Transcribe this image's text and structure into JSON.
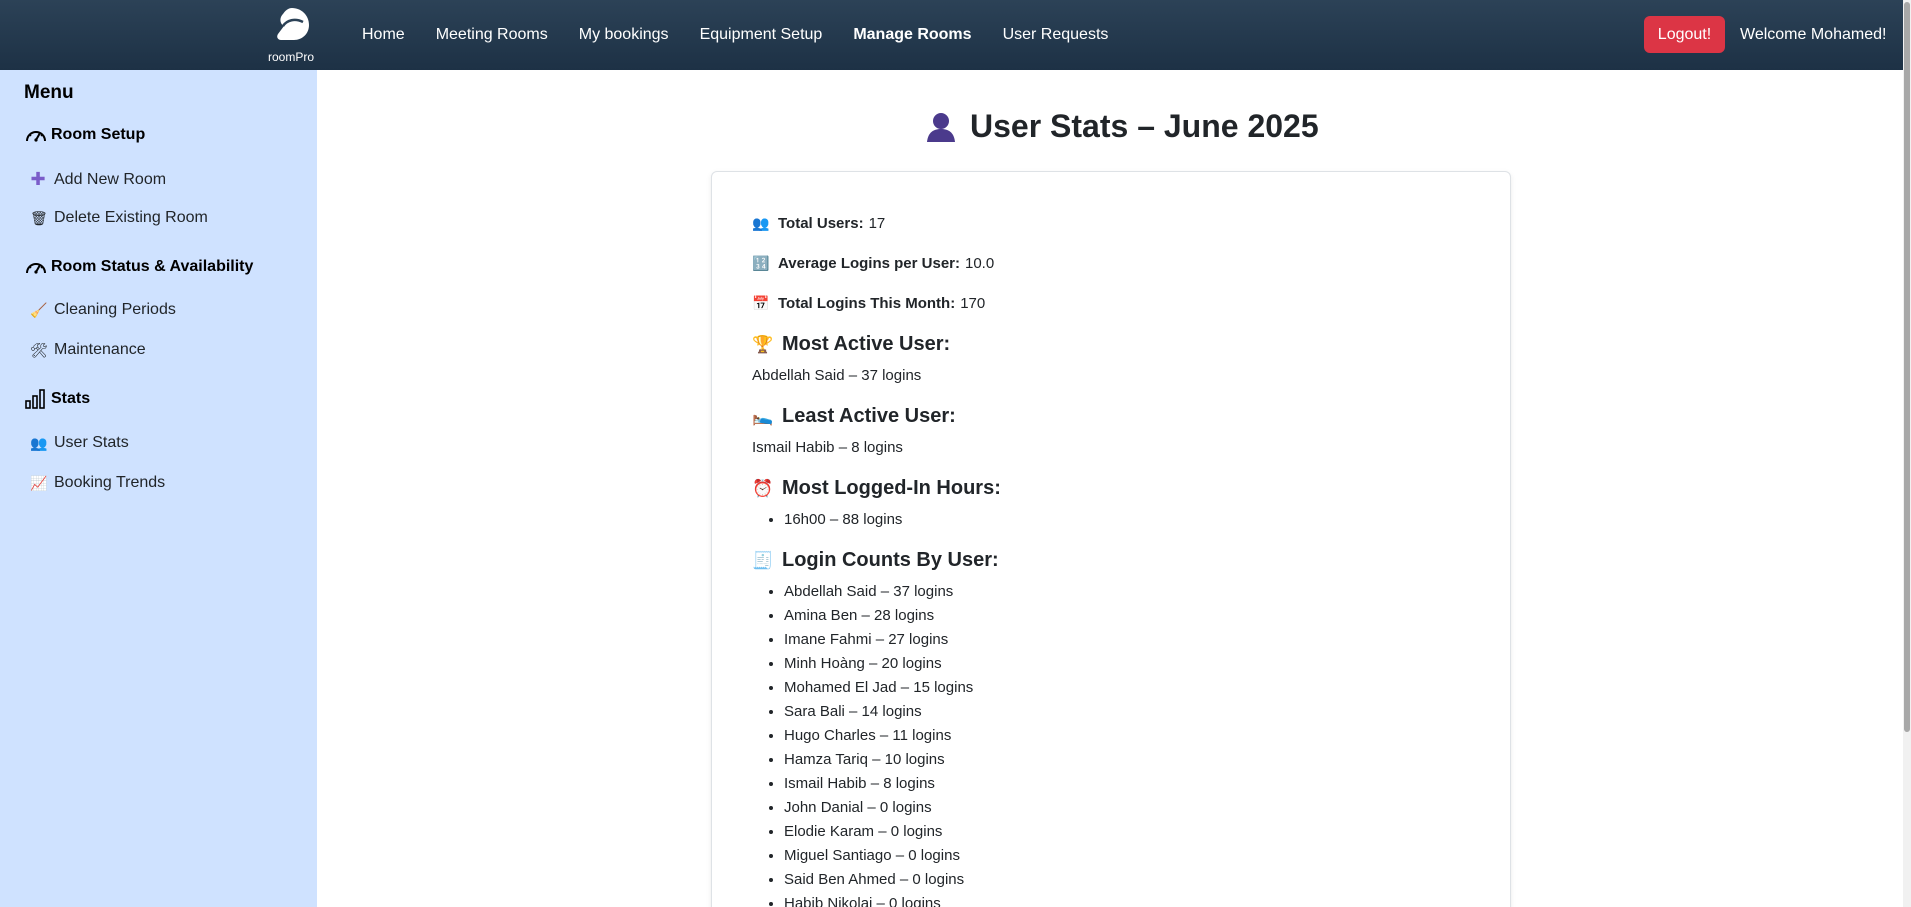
{
  "nav": {
    "logo_text": "roomPro",
    "links": [
      "Home",
      "Meeting Rooms",
      "My bookings",
      "Equipment Setup",
      "Manage Rooms",
      "User Requests"
    ],
    "active": "Manage Rooms",
    "logout_label": "Logout!",
    "welcome": "Welcome Mohamed!"
  },
  "sidebar": {
    "title": "Menu",
    "sections": [
      {
        "label": "Room Setup",
        "icon": "speedometer-icon",
        "items": [
          {
            "label": "Add New Room",
            "icon": "plus-icon",
            "glyph": "➕"
          },
          {
            "label": "Delete Existing Room",
            "icon": "wastebasket-icon",
            "glyph": "🗑"
          }
        ]
      },
      {
        "label": "Room Status & Availability",
        "icon": "speedometer-icon",
        "items": [
          {
            "label": "Cleaning Periods",
            "icon": "broom-icon",
            "glyph": "🧹"
          },
          {
            "label": "Maintenance",
            "icon": "tools-icon",
            "glyph": "🛠"
          }
        ]
      },
      {
        "label": "Stats",
        "icon": "bar-chart-icon",
        "items": [
          {
            "label": "User Stats",
            "icon": "users-icon",
            "glyph": "👥"
          },
          {
            "label": "Booking Trends",
            "icon": "trend-chart-icon",
            "glyph": "📈"
          }
        ]
      }
    ]
  },
  "main": {
    "title": "User Stats – June 2025",
    "title_icon": "user-silhouette-icon",
    "stats": {
      "total_users_label": "Total Users:",
      "total_users_value": "17",
      "avg_logins_label": "Average Logins per User:",
      "avg_logins_value": "10.0",
      "total_logins_label": "Total Logins This Month:",
      "total_logins_value": "170"
    },
    "most_active_heading": "Most Active User:",
    "most_active_text": "Abdellah Said – 37 logins",
    "least_active_heading": "Least Active User:",
    "least_active_text": "Ismail Habib – 8 logins",
    "hours_heading": "Most Logged-In Hours:",
    "hours": [
      "16h00 – 88 logins"
    ],
    "counts_heading": "Login Counts By User:",
    "counts": [
      "Abdellah Said – 37 logins",
      "Amina Ben – 28 logins",
      "Imane Fahmi – 27 logins",
      "Minh Hoàng – 20 logins",
      "Mohamed El Jad – 15 logins",
      "Sara Bali – 14 logins",
      "Hugo Charles – 11 logins",
      "Hamza Tariq – 10 logins",
      "Ismail Habib – 8 logins",
      "John Danial – 0 logins",
      "Elodie Karam – 0 logins",
      "Miguel Santiago – 0 logins",
      "Said Ben Ahmed – 0 logins",
      "Habib Nikolai – 0 logins"
    ]
  }
}
